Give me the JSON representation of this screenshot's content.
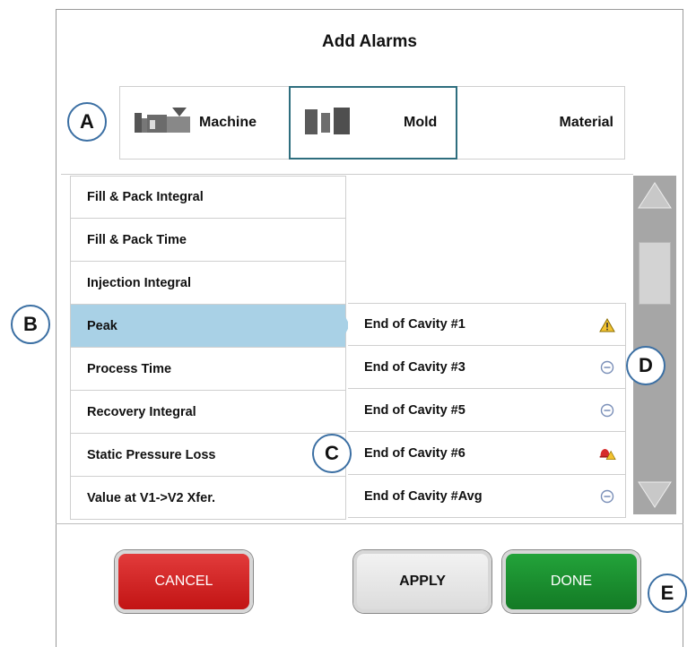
{
  "dialog": {
    "title": "Add Alarms"
  },
  "tabs": [
    {
      "label": "Machine",
      "icon": "machine-icon"
    },
    {
      "label": "Mold",
      "icon": "mold-icon",
      "selected": true
    },
    {
      "label": "Material"
    }
  ],
  "sensors": [
    {
      "label": "Fill & Pack Integral"
    },
    {
      "label": "Fill & Pack Time"
    },
    {
      "label": "Injection Integral"
    },
    {
      "label": "Peak",
      "selected": true
    },
    {
      "label": "Process Time"
    },
    {
      "label": "Recovery Integral"
    },
    {
      "label": "Static Pressure Loss"
    },
    {
      "label": "Value at V1->V2 Xfer."
    }
  ],
  "locations": [
    {
      "label": "End of Cavity #1",
      "status_icon": "warning-icon"
    },
    {
      "label": "End of Cavity #3",
      "status_icon": "minus-circle-icon"
    },
    {
      "label": "End of Cavity #5",
      "status_icon": "minus-circle-icon"
    },
    {
      "label": "End of Cavity #6",
      "status_icon": "alarm-bell-warning-icon"
    },
    {
      "label": "End of Cavity #Avg",
      "status_icon": "minus-circle-icon"
    }
  ],
  "buttons": {
    "cancel": "CANCEL",
    "apply": "APPLY",
    "done": "DONE"
  },
  "callouts": {
    "a": "A",
    "b": "B",
    "c": "C",
    "d": "D",
    "e": "E"
  },
  "colors": {
    "cancel": "#c21414",
    "done": "#137a25",
    "selected_row": "#a9d1e6",
    "selected_tab_border": "#2e6e7e"
  }
}
